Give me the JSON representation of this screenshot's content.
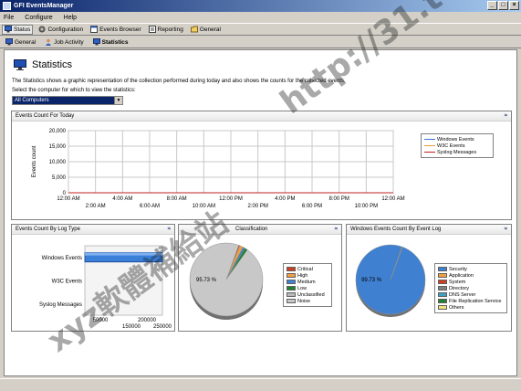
{
  "window": {
    "title": "GFI EventsManager",
    "controls": [
      "_",
      "□",
      "×"
    ]
  },
  "menu": [
    "File",
    "Configure",
    "Help"
  ],
  "toolbar": [
    {
      "label": "Status",
      "icon": "monitor-icon",
      "active": true
    },
    {
      "label": "Configuration",
      "icon": "gear-icon",
      "active": false
    },
    {
      "label": "Events Browser",
      "icon": "browser-icon",
      "active": false
    },
    {
      "label": "Reporting",
      "icon": "report-icon",
      "active": false
    },
    {
      "label": "General",
      "icon": "folder-icon",
      "active": false
    }
  ],
  "subnav": [
    {
      "label": "General",
      "icon": "monitor-icon",
      "bold": false
    },
    {
      "label": "Job Activity",
      "icon": "person-icon",
      "bold": false
    },
    {
      "label": "Statistics",
      "icon": "monitor-icon",
      "bold": true
    }
  ],
  "page": {
    "title": "Statistics",
    "description": "The Statistics shows a graphic representation of the collection performed during today and also shows the counts for the collected events.",
    "select_label": "Select the computer for which to view the statistics:",
    "select_value": "All Computers"
  },
  "panels": {
    "events_today": {
      "title": "Events Count For Today"
    },
    "by_log_type": {
      "title": "Events Count By Log Type"
    },
    "by_classification": {
      "title": "Classification"
    },
    "by_event_log": {
      "title": "Windows Events Count By Event Log"
    }
  },
  "chart_data": [
    {
      "type": "line",
      "title": "Events Count For Today",
      "ylabel": "Events count",
      "ylim": [
        0,
        20000
      ],
      "y_ticks": [
        "20,000",
        "15,000",
        "10,000",
        "5,000",
        "0"
      ],
      "x_ticks_top": [
        "12:00 AM",
        "4:00 AM",
        "8:00 AM",
        "12:00 PM",
        "4:00 PM",
        "8:00 PM",
        "12:00 AM"
      ],
      "x_ticks_bottom": [
        "2:00 AM",
        "6:00 AM",
        "10:00 AM",
        "2:00 PM",
        "6:00 PM",
        "10:00 PM"
      ],
      "grid": true,
      "legend_position": "right",
      "series": [
        {
          "name": "Windows Events",
          "color": "#3a6fd8",
          "values": [
            0,
            0,
            0,
            0,
            0,
            0,
            0
          ]
        },
        {
          "name": "W3C Events",
          "color": "#e89a3a",
          "values": [
            0,
            0,
            0,
            0,
            0,
            0,
            0
          ]
        },
        {
          "name": "Syslog Messages",
          "color": "#c02020",
          "values": [
            0,
            0,
            0,
            0,
            0,
            0,
            0
          ]
        }
      ]
    },
    {
      "type": "bar",
      "title": "Events Count By Log Type",
      "categories": [
        "Windows Events",
        "W3C Events",
        "Syslog Messages"
      ],
      "values": [
        250000,
        0,
        0
      ],
      "x_ticks_top": [
        "50000",
        "200000"
      ],
      "x_ticks_bottom": [
        "150000",
        "250000"
      ],
      "color": "#3a7fd8"
    },
    {
      "type": "pie",
      "title": "Classification",
      "data_label": "95.73 %",
      "categories": [
        "Critical",
        "High",
        "Medium",
        "Low",
        "Unclassified",
        "Noise"
      ],
      "colors": [
        "#d04020",
        "#f0a040",
        "#4080d0",
        "#208030",
        "#b8b8b8",
        "#c8c8c8"
      ],
      "values": [
        0.5,
        1.5,
        1.0,
        1.27,
        0,
        95.73
      ]
    },
    {
      "type": "pie",
      "title": "Windows Events Count By Event Log",
      "data_label": "99.73 %",
      "categories": [
        "Security",
        "Application",
        "System",
        "Directory",
        "DNS Server",
        "File Replication Service",
        "Others"
      ],
      "colors": [
        "#4080d0",
        "#f0a040",
        "#d04020",
        "#808080",
        "#40a0c0",
        "#208030",
        "#f0e080"
      ],
      "values": [
        99.73,
        0.1,
        0.1,
        0.02,
        0.02,
        0.02,
        0.01
      ]
    }
  ],
  "watermark": {
    "url": "http://31.to",
    "chinese": "xyz軟體補給站"
  },
  "colors": {
    "titlebar": "#0a246a",
    "accent": "#0a246a",
    "panel_bg": "#ffffff",
    "chrome": "#d4d0c8"
  }
}
